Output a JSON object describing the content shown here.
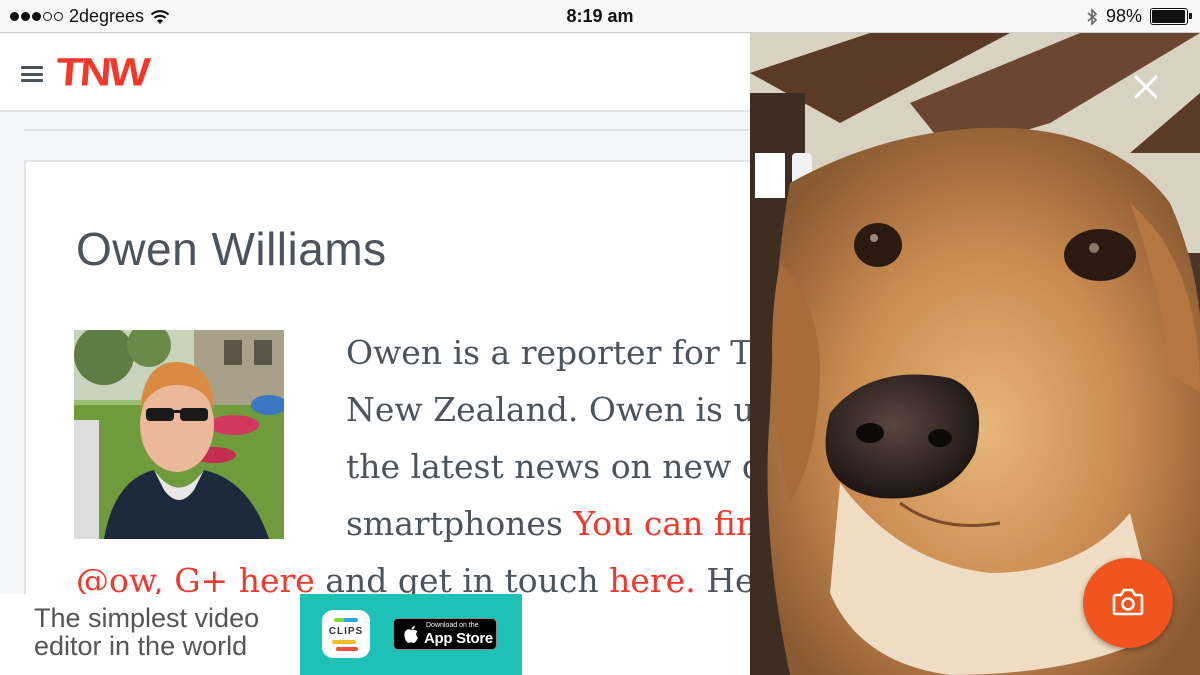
{
  "status_bar": {
    "carrier": "2degrees",
    "signal_bars": 3,
    "time": "8:19 am",
    "battery_percent": "98%",
    "battery_level": 0.98,
    "icons": [
      "signal-dots-icon",
      "wifi-icon",
      "bluetooth-icon",
      "battery-icon"
    ]
  },
  "header": {
    "logo": "TNW",
    "menu_icon": "hamburger-icon"
  },
  "author": {
    "name": "Owen Williams",
    "bio_line1": "Owen is a reporter for Th",
    "bio_line2": "New Zealand. Owen is u",
    "bio_line3": "the latest news on new d",
    "bio_line4_text": "smartphones ",
    "bio_line4_link": "You can fin",
    "bio_line5_link1": "@ow",
    "bio_line5_sep": ", ",
    "bio_line5_link2": "G+ here",
    "bio_line5_text": " and get in touch ",
    "bio_line5_link3": "here.",
    "bio_line5_tail": " He"
  },
  "ad": {
    "line1": "The simplest video",
    "line2": "editor in the world",
    "app_name": "CLIPS",
    "store_small": "Download on the",
    "store_big": "App Store"
  },
  "camera": {
    "close_icon": "close-icon",
    "shutter_icon": "camera-icon"
  },
  "colors": {
    "accent": "#f2382a",
    "shutter": "#f2541f",
    "ad_teal": "#1fc1b6",
    "text": "#4b545d"
  }
}
